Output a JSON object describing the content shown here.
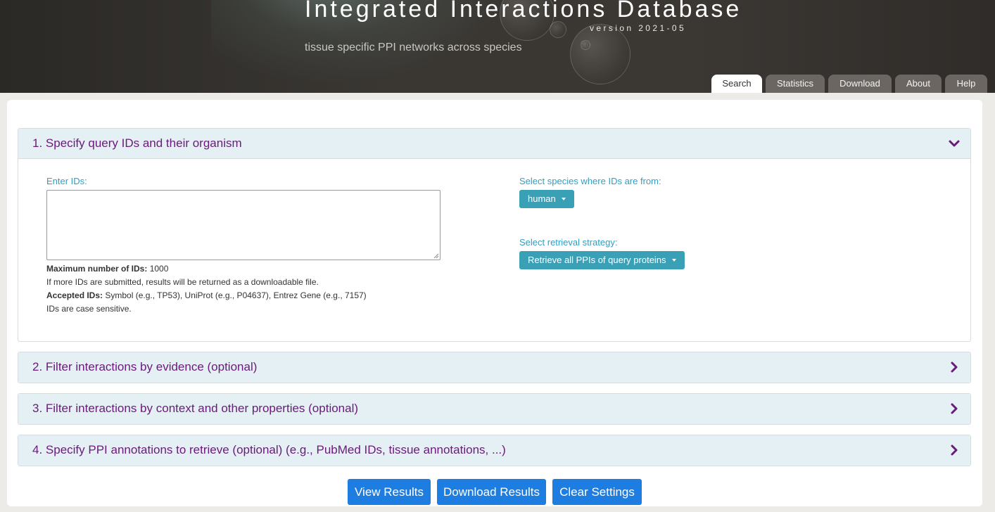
{
  "header": {
    "title": "Integrated Interactions Database",
    "version": "version 2021-05",
    "subtitle": "tissue specific PPI networks across species"
  },
  "nav": {
    "tabs": [
      {
        "label": "Search",
        "active": true
      },
      {
        "label": "Statistics",
        "active": false
      },
      {
        "label": "Download",
        "active": false
      },
      {
        "label": "About",
        "active": false
      },
      {
        "label": "Help",
        "active": false
      }
    ]
  },
  "sections": [
    {
      "title": "1. Specify query IDs and their organism",
      "expanded": true,
      "icon": "chevron-down-icon"
    },
    {
      "title": "2. Filter interactions by evidence (optional)",
      "expanded": false,
      "icon": "chevron-right-icon"
    },
    {
      "title": "3. Filter interactions by context and other properties (optional)",
      "expanded": false,
      "icon": "chevron-right-icon"
    },
    {
      "title": "4. Specify PPI annotations to retrieve (optional) (e.g., PubMed IDs, tissue annotations, ...)",
      "expanded": false,
      "icon": "chevron-right-icon"
    }
  ],
  "query": {
    "ids_label": "Enter IDs:",
    "ids_value": "",
    "max_ids_label": "Maximum number of IDs:",
    "max_ids_value": "1000",
    "more_ids_note": "If more IDs are submitted, results will be returned as a downloadable file.",
    "accepted_label": "Accepted IDs:",
    "accepted_value": "Symbol (e.g., TP53), UniProt (e.g., P04637), Entrez Gene (e.g., 7157)",
    "case_note": "IDs are case sensitive.",
    "species_label": "Select species where IDs are from:",
    "species_value": "human",
    "strategy_label": "Select retrieval strategy:",
    "strategy_value": "Retrieve all PPIs of query proteins"
  },
  "actions": {
    "view": "View Results",
    "download": "Download Results",
    "clear": "Clear Settings"
  },
  "colors": {
    "section_title": "#6a1a7a",
    "field_label": "#2f9fc2",
    "dropdown_bg": "#3aa0b6",
    "action_bg": "#1e7de0",
    "section_head_bg": "#e4f0f4"
  }
}
